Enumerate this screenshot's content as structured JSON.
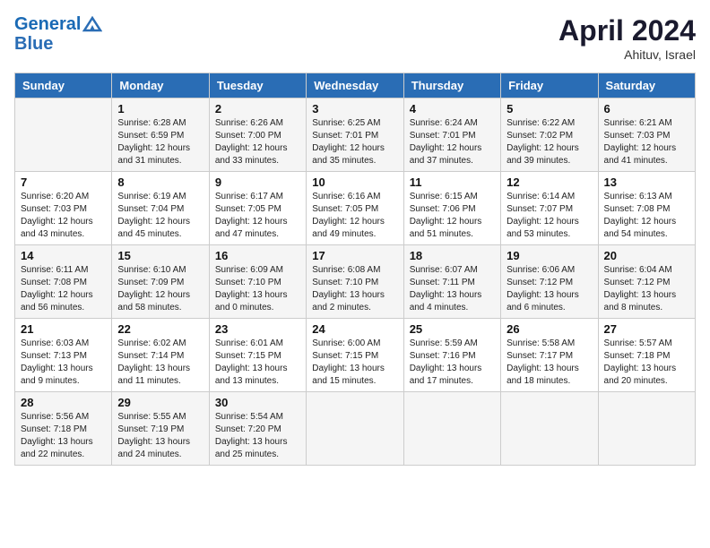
{
  "header": {
    "logo_line1": "General",
    "logo_line2": "Blue",
    "month_title": "April 2024",
    "location": "Ahituv, Israel"
  },
  "weekdays": [
    "Sunday",
    "Monday",
    "Tuesday",
    "Wednesday",
    "Thursday",
    "Friday",
    "Saturday"
  ],
  "weeks": [
    [
      {
        "day": "",
        "sunrise": "",
        "sunset": "",
        "daylight": ""
      },
      {
        "day": "1",
        "sunrise": "Sunrise: 6:28 AM",
        "sunset": "Sunset: 6:59 PM",
        "daylight": "Daylight: 12 hours and 31 minutes."
      },
      {
        "day": "2",
        "sunrise": "Sunrise: 6:26 AM",
        "sunset": "Sunset: 7:00 PM",
        "daylight": "Daylight: 12 hours and 33 minutes."
      },
      {
        "day": "3",
        "sunrise": "Sunrise: 6:25 AM",
        "sunset": "Sunset: 7:01 PM",
        "daylight": "Daylight: 12 hours and 35 minutes."
      },
      {
        "day": "4",
        "sunrise": "Sunrise: 6:24 AM",
        "sunset": "Sunset: 7:01 PM",
        "daylight": "Daylight: 12 hours and 37 minutes."
      },
      {
        "day": "5",
        "sunrise": "Sunrise: 6:22 AM",
        "sunset": "Sunset: 7:02 PM",
        "daylight": "Daylight: 12 hours and 39 minutes."
      },
      {
        "day": "6",
        "sunrise": "Sunrise: 6:21 AM",
        "sunset": "Sunset: 7:03 PM",
        "daylight": "Daylight: 12 hours and 41 minutes."
      }
    ],
    [
      {
        "day": "7",
        "sunrise": "Sunrise: 6:20 AM",
        "sunset": "Sunset: 7:03 PM",
        "daylight": "Daylight: 12 hours and 43 minutes."
      },
      {
        "day": "8",
        "sunrise": "Sunrise: 6:19 AM",
        "sunset": "Sunset: 7:04 PM",
        "daylight": "Daylight: 12 hours and 45 minutes."
      },
      {
        "day": "9",
        "sunrise": "Sunrise: 6:17 AM",
        "sunset": "Sunset: 7:05 PM",
        "daylight": "Daylight: 12 hours and 47 minutes."
      },
      {
        "day": "10",
        "sunrise": "Sunrise: 6:16 AM",
        "sunset": "Sunset: 7:05 PM",
        "daylight": "Daylight: 12 hours and 49 minutes."
      },
      {
        "day": "11",
        "sunrise": "Sunrise: 6:15 AM",
        "sunset": "Sunset: 7:06 PM",
        "daylight": "Daylight: 12 hours and 51 minutes."
      },
      {
        "day": "12",
        "sunrise": "Sunrise: 6:14 AM",
        "sunset": "Sunset: 7:07 PM",
        "daylight": "Daylight: 12 hours and 53 minutes."
      },
      {
        "day": "13",
        "sunrise": "Sunrise: 6:13 AM",
        "sunset": "Sunset: 7:08 PM",
        "daylight": "Daylight: 12 hours and 54 minutes."
      }
    ],
    [
      {
        "day": "14",
        "sunrise": "Sunrise: 6:11 AM",
        "sunset": "Sunset: 7:08 PM",
        "daylight": "Daylight: 12 hours and 56 minutes."
      },
      {
        "day": "15",
        "sunrise": "Sunrise: 6:10 AM",
        "sunset": "Sunset: 7:09 PM",
        "daylight": "Daylight: 12 hours and 58 minutes."
      },
      {
        "day": "16",
        "sunrise": "Sunrise: 6:09 AM",
        "sunset": "Sunset: 7:10 PM",
        "daylight": "Daylight: 13 hours and 0 minutes."
      },
      {
        "day": "17",
        "sunrise": "Sunrise: 6:08 AM",
        "sunset": "Sunset: 7:10 PM",
        "daylight": "Daylight: 13 hours and 2 minutes."
      },
      {
        "day": "18",
        "sunrise": "Sunrise: 6:07 AM",
        "sunset": "Sunset: 7:11 PM",
        "daylight": "Daylight: 13 hours and 4 minutes."
      },
      {
        "day": "19",
        "sunrise": "Sunrise: 6:06 AM",
        "sunset": "Sunset: 7:12 PM",
        "daylight": "Daylight: 13 hours and 6 minutes."
      },
      {
        "day": "20",
        "sunrise": "Sunrise: 6:04 AM",
        "sunset": "Sunset: 7:12 PM",
        "daylight": "Daylight: 13 hours and 8 minutes."
      }
    ],
    [
      {
        "day": "21",
        "sunrise": "Sunrise: 6:03 AM",
        "sunset": "Sunset: 7:13 PM",
        "daylight": "Daylight: 13 hours and 9 minutes."
      },
      {
        "day": "22",
        "sunrise": "Sunrise: 6:02 AM",
        "sunset": "Sunset: 7:14 PM",
        "daylight": "Daylight: 13 hours and 11 minutes."
      },
      {
        "day": "23",
        "sunrise": "Sunrise: 6:01 AM",
        "sunset": "Sunset: 7:15 PM",
        "daylight": "Daylight: 13 hours and 13 minutes."
      },
      {
        "day": "24",
        "sunrise": "Sunrise: 6:00 AM",
        "sunset": "Sunset: 7:15 PM",
        "daylight": "Daylight: 13 hours and 15 minutes."
      },
      {
        "day": "25",
        "sunrise": "Sunrise: 5:59 AM",
        "sunset": "Sunset: 7:16 PM",
        "daylight": "Daylight: 13 hours and 17 minutes."
      },
      {
        "day": "26",
        "sunrise": "Sunrise: 5:58 AM",
        "sunset": "Sunset: 7:17 PM",
        "daylight": "Daylight: 13 hours and 18 minutes."
      },
      {
        "day": "27",
        "sunrise": "Sunrise: 5:57 AM",
        "sunset": "Sunset: 7:18 PM",
        "daylight": "Daylight: 13 hours and 20 minutes."
      }
    ],
    [
      {
        "day": "28",
        "sunrise": "Sunrise: 5:56 AM",
        "sunset": "Sunset: 7:18 PM",
        "daylight": "Daylight: 13 hours and 22 minutes."
      },
      {
        "day": "29",
        "sunrise": "Sunrise: 5:55 AM",
        "sunset": "Sunset: 7:19 PM",
        "daylight": "Daylight: 13 hours and 24 minutes."
      },
      {
        "day": "30",
        "sunrise": "Sunrise: 5:54 AM",
        "sunset": "Sunset: 7:20 PM",
        "daylight": "Daylight: 13 hours and 25 minutes."
      },
      {
        "day": "",
        "sunrise": "",
        "sunset": "",
        "daylight": ""
      },
      {
        "day": "",
        "sunrise": "",
        "sunset": "",
        "daylight": ""
      },
      {
        "day": "",
        "sunrise": "",
        "sunset": "",
        "daylight": ""
      },
      {
        "day": "",
        "sunrise": "",
        "sunset": "",
        "daylight": ""
      }
    ]
  ]
}
